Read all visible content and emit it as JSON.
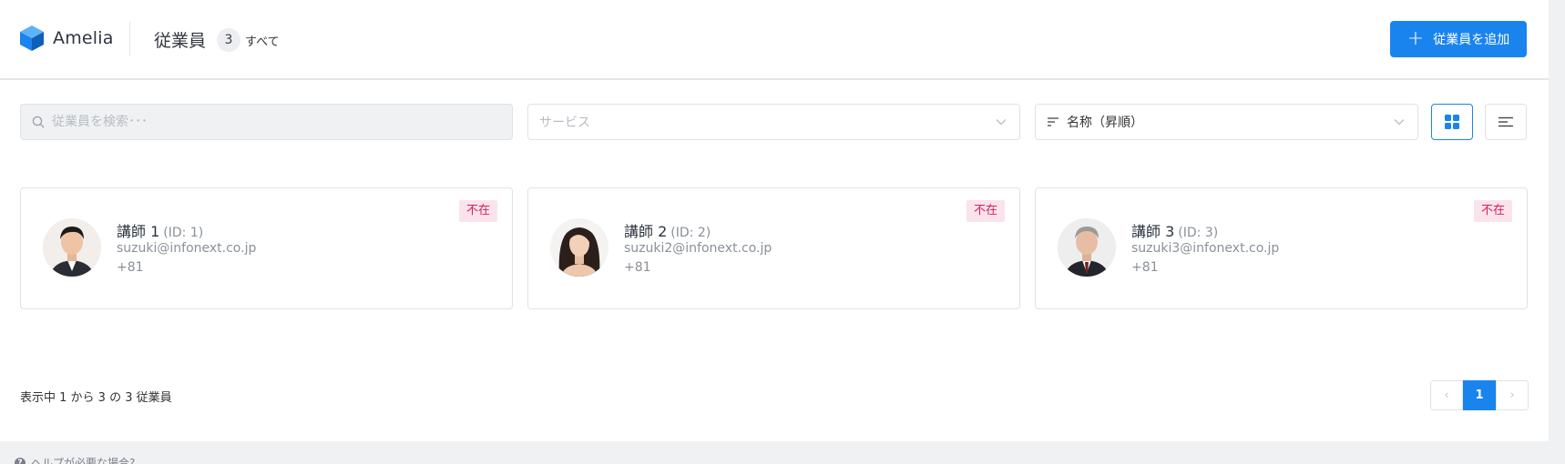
{
  "app": {
    "name": "Amelia"
  },
  "header": {
    "title": "従業員",
    "count": "3",
    "count_label": "すべて",
    "add_button_label": "従業員を追加"
  },
  "filters": {
    "search_placeholder": "従業員を検索･･･",
    "service_placeholder": "サービス",
    "sort_value": "名称（昇順）"
  },
  "view_toggle": {
    "active": "grid"
  },
  "employees": [
    {
      "name": "講師 1",
      "id_label": "(ID: 1)",
      "email": "suzuki@infonext.co.jp",
      "phone": "+81",
      "status": "不在"
    },
    {
      "name": "講師 2",
      "id_label": "(ID: 2)",
      "email": "suzuki2@infonext.co.jp",
      "phone": "+81",
      "status": "不在"
    },
    {
      "name": "講師 3",
      "id_label": "(ID: 3)",
      "email": "suzuki3@infonext.co.jp",
      "phone": "+81",
      "status": "不在"
    }
  ],
  "footer": {
    "summary": "表示中 1 から 3 の 3 従業員",
    "pagination": {
      "current_page": "1",
      "prev_icon": "‹",
      "next_icon": "›"
    }
  },
  "help": {
    "label": "ヘルプが必要な場合?"
  },
  "colors": {
    "accent": "#1a84ee",
    "status_bg": "#fbe3ec",
    "status_text": "#d81b60"
  }
}
